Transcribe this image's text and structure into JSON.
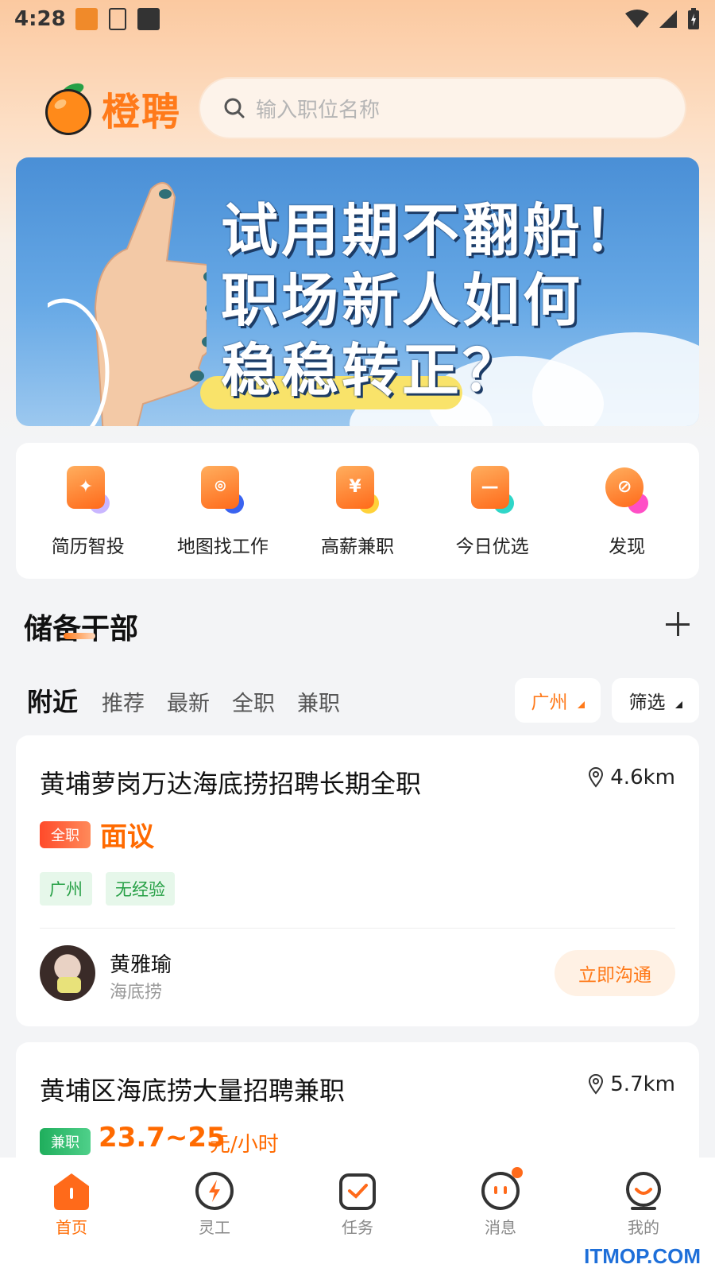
{
  "status": {
    "time": "4:28"
  },
  "app": {
    "brand": "橙聘"
  },
  "search": {
    "placeholder": "输入职位名称"
  },
  "banner": {
    "lines": [
      "试用期不翻船！",
      "职场新人如何",
      "稳稳转正？"
    ]
  },
  "quick_entries": [
    {
      "label": "简历智投",
      "icon": "sparkle-doc-icon"
    },
    {
      "label": "地图找工作",
      "icon": "map-pin-icon"
    },
    {
      "label": "高薪兼职",
      "icon": "yuan-icon"
    },
    {
      "label": "今日优选",
      "icon": "box-icon"
    },
    {
      "label": "发现",
      "icon": "compass-icon"
    }
  ],
  "section": {
    "title": "储备干部"
  },
  "tabs": [
    "附近",
    "推荐",
    "最新",
    "全职",
    "兼职"
  ],
  "filters": {
    "city": "广州",
    "filter": "筛选"
  },
  "jobs": [
    {
      "title": "黄埔萝岗万达海底捞招聘长期全职",
      "distance": "4.6km",
      "type": "全职",
      "salary": "面议",
      "tags": [
        "广州",
        "无经验"
      ],
      "hr_name": "黄雅瑜",
      "company": "海底捞",
      "action": "立即沟通"
    },
    {
      "title": "黄埔区海底捞大量招聘兼职",
      "distance": "5.7km",
      "type": "兼职",
      "salary": "23.7~25",
      "salary_unit": "元/小时"
    }
  ],
  "tabbar": [
    {
      "label": "首页",
      "active": true
    },
    {
      "label": "灵工"
    },
    {
      "label": "任务"
    },
    {
      "label": "消息"
    },
    {
      "label": "我的"
    }
  ],
  "watermark": "ITMOP.COM",
  "colors": {
    "accent": "#ff7a1a",
    "tag_green": "#27a046",
    "fulltime_badge": "#ff5a3c",
    "parttime_badge": "#2bb673"
  }
}
